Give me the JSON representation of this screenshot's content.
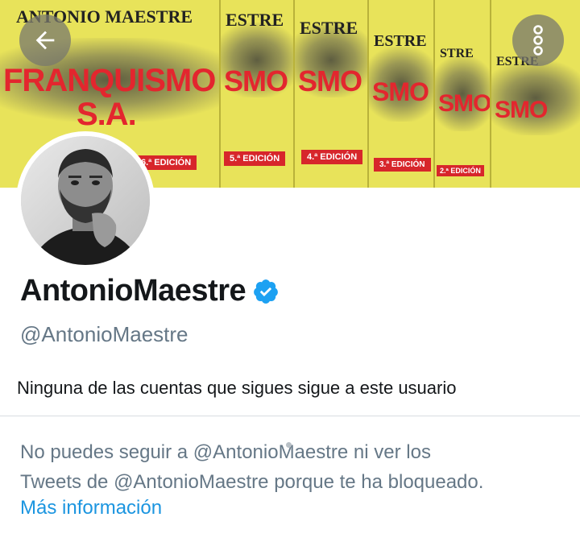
{
  "banner": {
    "books": [
      {
        "author": "ANTONIO MAESTRE",
        "title_line1": "FRANQUISMO",
        "title_line2": "S.A.",
        "edition": "6.ª EDICIÓN"
      },
      {
        "author": "ESTRE",
        "title": "SMO",
        "edition": "5.ª EDICIÓN"
      },
      {
        "author": "ESTRE",
        "title": "SMO",
        "edition": "4.ª EDICIÓN"
      },
      {
        "author": "ESTRE",
        "title": "SMO",
        "edition": "3.ª EDICIÓN"
      },
      {
        "author": "STRE",
        "title": "SMO",
        "edition": "2.ª EDICIÓN"
      },
      {
        "author": "ESTRE",
        "title": "SMO",
        "edition": ""
      }
    ]
  },
  "toolbar": {
    "back_icon": "arrow-left-icon",
    "more_icon": "more-vertical-icon"
  },
  "profile": {
    "display_name": "AntonioMaestre",
    "verified_icon": "verified-badge-icon",
    "handle": "@AntonioMaestre",
    "follow_note": "Ninguna de las cuentas que sigues sigue a este usuario",
    "blocked_line1": "No puedes seguir a @AntonioMaestre ni ver los",
    "blocked_line2": "Tweets de @AntonioMaestre porque te ha bloqueado.",
    "more_info_link": "Más información"
  },
  "colors": {
    "accent": "#1b95e0",
    "verified": "#1da1f2",
    "text_primary": "#14171a",
    "text_secondary": "#657786"
  }
}
